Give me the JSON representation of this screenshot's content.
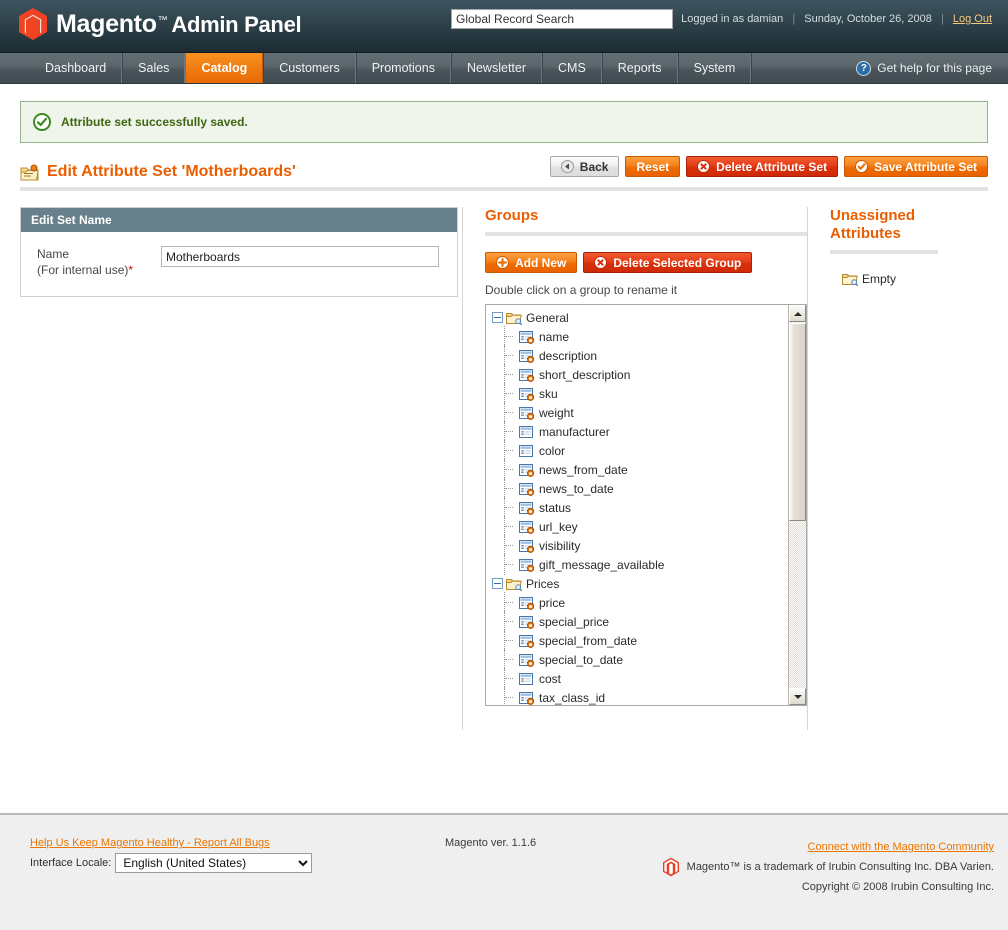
{
  "header": {
    "logo_name": "magento-logo",
    "brand": "Magento",
    "trademark": "™",
    "panel_label": "Admin Panel",
    "search_placeholder": "Global Record Search",
    "search_value": "Global Record Search",
    "logged_in_as": "Logged in as damian",
    "date": "Sunday, October 26, 2008",
    "logout_label": "Log Out",
    "separator": "|"
  },
  "nav": {
    "items": [
      {
        "label": "Dashboard",
        "active": false
      },
      {
        "label": "Sales",
        "active": false
      },
      {
        "label": "Catalog",
        "active": true
      },
      {
        "label": "Customers",
        "active": false
      },
      {
        "label": "Promotions",
        "active": false
      },
      {
        "label": "Newsletter",
        "active": false
      },
      {
        "label": "CMS",
        "active": false
      },
      {
        "label": "Reports",
        "active": false
      },
      {
        "label": "System",
        "active": false
      }
    ],
    "help_label": "Get help for this page",
    "help_icon": "question-mark-icon"
  },
  "message": {
    "icon": "success-check-icon",
    "text": "Attribute set successfully saved."
  },
  "page": {
    "title": "Edit Attribute Set 'Motherboards'",
    "title_icon": "attribute-set-icon",
    "buttons": [
      {
        "label": "Back",
        "style": "grey",
        "icon": "back-arrow-icon"
      },
      {
        "label": "Reset",
        "style": "orange",
        "icon": "none"
      },
      {
        "label": "Delete Attribute Set",
        "style": "red",
        "icon": "delete-x-icon"
      },
      {
        "label": "Save Attribute Set",
        "style": "orange",
        "icon": "save-check-icon"
      }
    ]
  },
  "edit_set": {
    "panel_title": "Edit Set Name",
    "name_label": "Name",
    "name_sublabel": "(For internal use)",
    "required_marker": "*",
    "name_value": "Motherboards"
  },
  "groups": {
    "title": "Groups",
    "add_new_label": "Add New",
    "add_new_icon": "plus-circle-icon",
    "delete_label": "Delete Selected Group",
    "delete_icon": "delete-x-icon",
    "hint": "Double click on a group to rename it",
    "tree": [
      {
        "label": "General",
        "type": "group",
        "expanded": true,
        "children": [
          {
            "label": "name",
            "system": true
          },
          {
            "label": "description",
            "system": true
          },
          {
            "label": "short_description",
            "system": true
          },
          {
            "label": "sku",
            "system": true
          },
          {
            "label": "weight",
            "system": true
          },
          {
            "label": "manufacturer",
            "system": false
          },
          {
            "label": "color",
            "system": false
          },
          {
            "label": "news_from_date",
            "system": true
          },
          {
            "label": "news_to_date",
            "system": true
          },
          {
            "label": "status",
            "system": true
          },
          {
            "label": "url_key",
            "system": true
          },
          {
            "label": "visibility",
            "system": true
          },
          {
            "label": "gift_message_available",
            "system": true
          }
        ]
      },
      {
        "label": "Prices",
        "type": "group",
        "expanded": true,
        "children": [
          {
            "label": "price",
            "system": true
          },
          {
            "label": "special_price",
            "system": true
          },
          {
            "label": "special_from_date",
            "system": true
          },
          {
            "label": "special_to_date",
            "system": true
          },
          {
            "label": "cost",
            "system": false
          },
          {
            "label": "tax_class_id",
            "system": true
          }
        ]
      }
    ],
    "scrollbar": {
      "up_icon": "scroll-up-arrow-icon",
      "down_icon": "scroll-down-arrow-icon"
    }
  },
  "unassigned": {
    "title_line1": "Unassigned",
    "title_line2": "Attributes",
    "empty_label": "Empty",
    "empty_icon": "folder-search-icon"
  },
  "footer": {
    "report_bugs": "Help Us Keep Magento Healthy - Report All Bugs",
    "locale_label": "Interface Locale:",
    "locale_value": "English (United States)",
    "locale_options": [
      "English (United States)"
    ],
    "version": "Magento ver. 1.1.6",
    "community_link": "Connect with the Magento Community",
    "trademark_line": "Magento™ is a trademark of Irubin Consulting Inc. DBA Varien.",
    "copyright": "Copyright © 2008 Irubin Consulting Inc.",
    "logo_icon": "magento-logo-icon"
  }
}
